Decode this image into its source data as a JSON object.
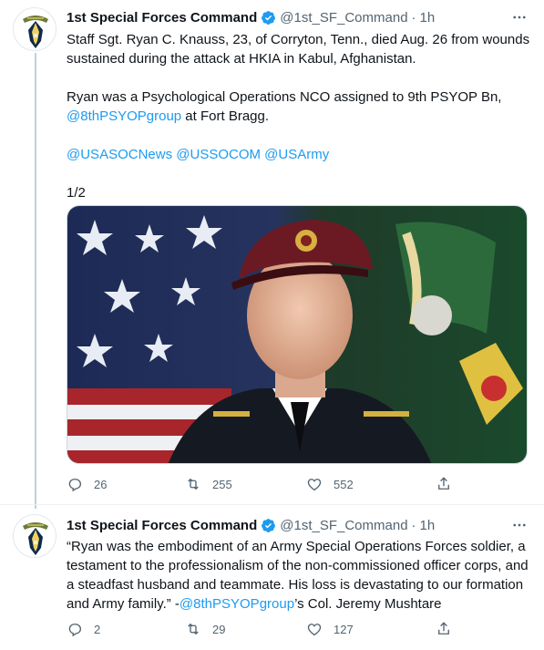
{
  "account": {
    "name": "1st Special Forces Command",
    "handle": "@1st_SF_Command",
    "avatar_icon": "special-forces-crest-icon",
    "verified_icon": "verified-badge-icon",
    "accent_color": "#1d9bf0"
  },
  "tweets": [
    {
      "time": "1h",
      "paragraphs": [
        {
          "text": "Staff Sgt. Ryan C. Knauss, 23, of Corryton, Tenn., died Aug. 26 from wounds sustained during the attack at HKIA in Kabul, Afghanistan."
        },
        {
          "pre": "Ryan was a Psychological Operations NCO assigned to 9th PSYOP Bn, ",
          "link": "@8thPSYOPgroup",
          "post": " at Fort Bragg."
        },
        {
          "mentions": [
            "@USASOCNews",
            "@USSOCOM",
            "@USArmy"
          ]
        },
        {
          "text": "1/2"
        }
      ],
      "media_alt": "Portrait photo of a soldier in a maroon beret in front of an American flag",
      "actions": {
        "replies": "26",
        "retweets": "255",
        "likes": "552"
      }
    },
    {
      "time": "1h",
      "text_pre": "“Ryan was the embodiment of an Army Special Operations Forces soldier, a testament to the professionalism of the non-commissioned officer corps, and a steadfast husband and teammate. His loss is devastating to our formation and Army family.” -",
      "link": "@8thPSYOPgroup",
      "text_post": "’s Col. Jeremy Mushtare",
      "actions": {
        "replies": "2",
        "retweets": "29",
        "likes": "127"
      }
    }
  ]
}
